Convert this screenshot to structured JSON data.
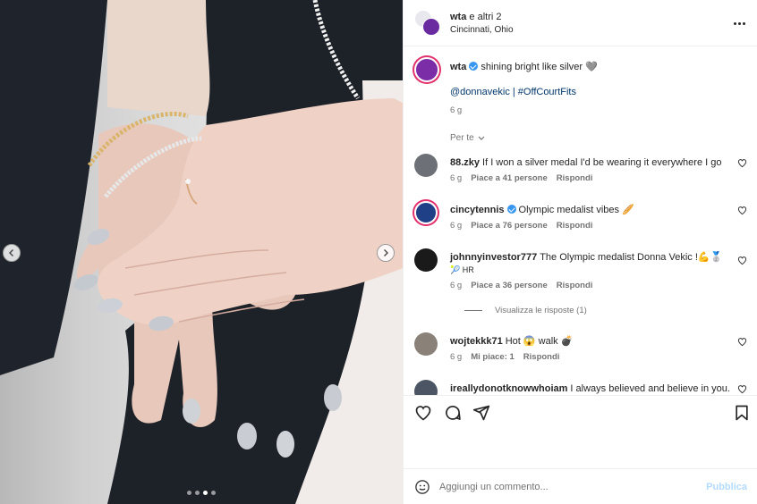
{
  "post": {
    "header": {
      "title_user": "wta",
      "title_rest": "e altri 2",
      "location": "Cincinnati, Ohio",
      "more_icon": "more-horizontal-icon"
    },
    "caption": {
      "username": "wta",
      "text": "shining bright like silver 🩶",
      "tags": "@donnavekic | #OffCourtFits",
      "time": "6 g"
    },
    "per_te_label": "Per te",
    "comments": [
      {
        "username": "88.zky",
        "verified": false,
        "text": "If I won a silver medal I'd be wearing it everywhere I go",
        "time": "6 g",
        "likes": "Piace a 41 persone",
        "reply": "Rispondi",
        "avatar_color": "#6e7078"
      },
      {
        "username": "cincytennis",
        "verified": true,
        "text": "Olympic medalist vibes 🥖",
        "time": "6 g",
        "likes": "Piace a 76 persone",
        "reply": "Rispondi",
        "avatar_color": "#1f3f86"
      },
      {
        "username": "johnnyinvestor777",
        "verified": false,
        "text": "The Olympic medalist Donna Vekic !💪🥈",
        "text2": "🎾 HR",
        "time": "6 g",
        "likes": "Piace a 36 persone",
        "reply": "Rispondi",
        "avatar_color": "#1a1a1a",
        "view_replies": "Visualizza le risposte (1)"
      },
      {
        "username": "wojtekkk71",
        "verified": false,
        "text": "Hot 😱 walk 💣",
        "time": "6 g",
        "likes": "Mi piace: 1",
        "reply": "Rispondi",
        "avatar_color": "#8a8178"
      },
      {
        "username": "ireallydonotknowwhoiam",
        "verified": false,
        "text": "I always believed and believe in you.",
        "avatar_color": "#4b5563"
      }
    ],
    "actions": {
      "like_icon": "heart-icon",
      "comment_icon": "comment-icon",
      "share_icon": "send-icon",
      "save_icon": "bookmark-icon"
    },
    "composer": {
      "placeholder": "Aggiungi un commento...",
      "publish": "Pubblica"
    },
    "carousel": {
      "slide_count": 4,
      "active_index": 2
    }
  }
}
